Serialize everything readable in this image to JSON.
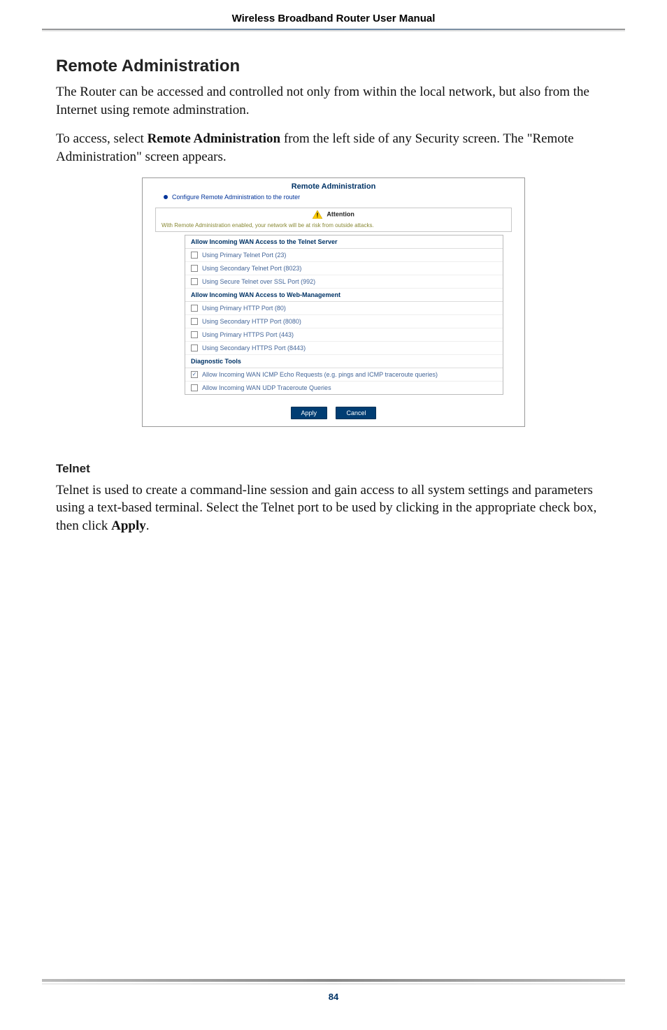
{
  "header": {
    "title": "Wireless Broadband Router User Manual"
  },
  "section": {
    "title": "Remote Administration",
    "para1": "The Router can be accessed and controlled not only from within the local network, but also from the Internet using remote adminstration.",
    "para2_pre": "To access, select ",
    "para2_bold": "Remote Administration",
    "para2_post": " from the left side of any Security screen. The \"Remote Administration\" screen appears."
  },
  "screenshot": {
    "title": "Remote Administration",
    "bullet": "Configure Remote Administration to the router",
    "attention_label": "Attention",
    "attention_text": "With Remote Administration enabled, your network will be at risk from outside attacks.",
    "telnet_hdr": "Allow Incoming WAN Access to the Telnet Server",
    "telnet_rows": [
      "Using Primary Telnet Port (23)",
      "Using Secondary Telnet Port (8023)",
      "Using Secure Telnet over SSL Port (992)"
    ],
    "web_hdr": "Allow Incoming WAN Access to Web-Management",
    "web_rows": [
      "Using Primary HTTP Port (80)",
      "Using Secondary HTTP Port (8080)",
      "Using Primary HTTPS Port (443)",
      "Using Secondary HTTPS Port (8443)"
    ],
    "diag_hdr": "Diagnostic Tools",
    "diag_rows": [
      {
        "label": "Allow Incoming WAN ICMP Echo Requests (e.g. pings and ICMP traceroute queries)",
        "checked": true
      },
      {
        "label": "Allow Incoming WAN UDP Traceroute Queries",
        "checked": false
      }
    ],
    "btn_apply": "Apply",
    "btn_cancel": "Cancel"
  },
  "telnet_section": {
    "title": "Telnet",
    "para_pre": "Telnet is used to create a command-line session and gain access to all system settings and parameters using a text-based terminal. Select the Telnet port to be used by clicking in the appropriate check box, then click ",
    "para_bold": "Apply",
    "para_post": "."
  },
  "footer": {
    "page": "84"
  }
}
